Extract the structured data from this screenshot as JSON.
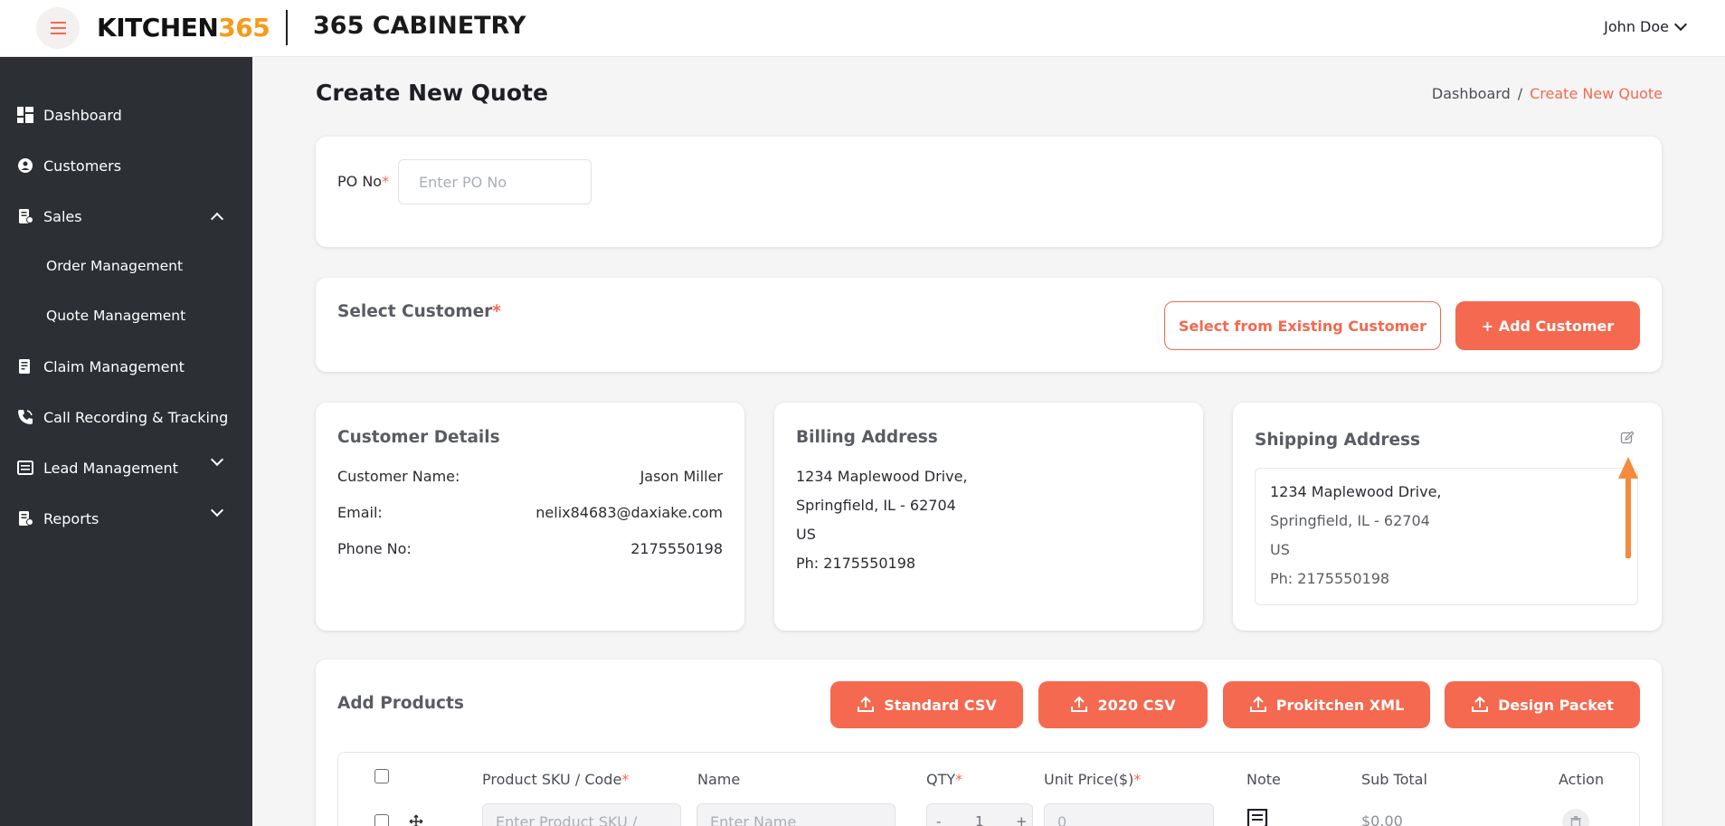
{
  "header": {
    "logo_text": "KITCHEN",
    "logo_num": "365",
    "company": "365 CABINETRY",
    "user": "John Doe"
  },
  "sidebar": {
    "items": [
      {
        "label": "Dashboard",
        "icon": "dashboard-icon"
      },
      {
        "label": "Customers",
        "icon": "customers-icon"
      },
      {
        "label": "Sales",
        "icon": "sales-icon",
        "expanded": true
      },
      {
        "label": "Order Management"
      },
      {
        "label": "Quote Management"
      },
      {
        "label": "Claim Management",
        "icon": "claim-icon"
      },
      {
        "label": "Call Recording & Tracking",
        "icon": "phone-icon"
      },
      {
        "label": "Lead Management",
        "icon": "lead-icon",
        "expanded": false
      },
      {
        "label": "Reports",
        "icon": "reports-icon",
        "expanded": false
      }
    ]
  },
  "page": {
    "title": "Create New Quote",
    "breadcrumb": {
      "home": "Dashboard",
      "sep": "/",
      "current": "Create New Quote"
    }
  },
  "po": {
    "label": "PO No",
    "required": "*",
    "placeholder": "Enter PO No"
  },
  "select_customer": {
    "title": "Select Customer",
    "required": "*",
    "existing_button": "Select from Existing Customer",
    "add_button": "+ Add Customer"
  },
  "customer_details": {
    "title": "Customer Details",
    "name_label": "Customer Name:",
    "name": "Jason Miller",
    "email_label": "Email:",
    "email": "nelix84683@daxiake.com",
    "phone_label": "Phone No:",
    "phone": "2175550198"
  },
  "billing": {
    "title": "Billing Address",
    "line1": "1234 Maplewood Drive,",
    "line2": "Springfield, IL - 62704",
    "line3": "US",
    "line4": "Ph: 2175550198"
  },
  "shipping": {
    "title": "Shipping Address",
    "line1": "1234 Maplewood Drive,",
    "line2": "Springfield, IL - 62704",
    "line3": "US",
    "line4": "Ph: 2175550198"
  },
  "products": {
    "title": "Add Products",
    "buttons": [
      "Standard CSV",
      "2020 CSV",
      "Prokitchen XML",
      "Design Packet"
    ],
    "columns": {
      "sku": "Product SKU / Code",
      "name": "Name",
      "qty": "QTY",
      "unit_price": "Unit Price($)",
      "note": "Note",
      "subtotal": "Sub Total",
      "action": "Action"
    },
    "row": {
      "sku_placeholder": "Enter Product SKU / Code",
      "name_placeholder": "Enter Name",
      "qty_minus": "-",
      "qty": "1",
      "qty_plus": "+",
      "unit_price": "0",
      "subtotal": "$0.00"
    }
  },
  "colors": {
    "accent": "#f4694f",
    "sidebar": "#2c2f34",
    "logo_num": "#f79a1a"
  }
}
